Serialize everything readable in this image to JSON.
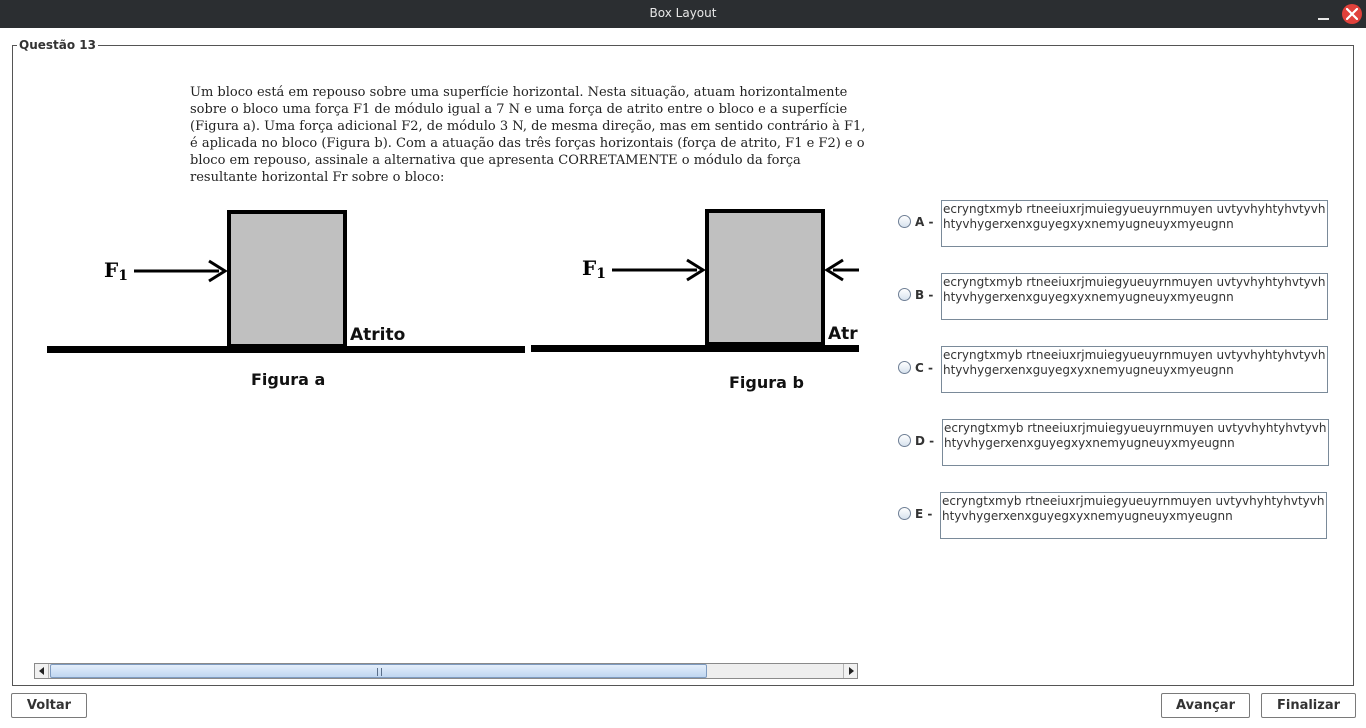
{
  "window": {
    "title": "Box Layout"
  },
  "group": {
    "title": "Questão 13"
  },
  "question": {
    "text": "Um bloco está em repouso sobre uma superfície horizontal. Nesta situação, atuam horizontalmente sobre o bloco uma força F1 de módulo igual a 7 N e uma força de atrito entre o bloco e a superfície (Figura a). Uma força adicional F2, de módulo 3 N, de mesma direção, mas em sentido contrário à F1, é aplicada no bloco (Figura b). Com a atuação das três forças horizontais (força de atrito, F1 e F2) e o bloco em repouso, assinale a alternativa que apresenta CORRETAMENTE o módulo da força resultante horizontal Fr sobre o bloco:"
  },
  "figure": {
    "force_symbol": "F",
    "force_subscript": "1",
    "friction_label_a": "Atrito",
    "friction_label_b": "Atr",
    "caption_a": "Figura a",
    "caption_b": "Figura b",
    "block_color": "#c0c0c0"
  },
  "scrollbar": {
    "position_fraction": 0.0,
    "visible_fraction": 0.83
  },
  "options": [
    {
      "letter": "A -",
      "text": "ecryngtxmyb rtneeiuxrjmuiegyueuyrnmuyen uvtyvhyhtyhvtyvhhtyvhygerxenxguyegxyxnemyugneuyxmyeugnn"
    },
    {
      "letter": "B -",
      "text": "ecryngtxmyb rtneeiuxrjmuiegyueuyrnmuyen uvtyvhyhtyhvtyvhhtyvhygerxenxguyegxyxnemyugneuyxmyeugnn"
    },
    {
      "letter": "C -",
      "text": "ecryngtxmyb rtneeiuxrjmuiegyueuyrnmuyen uvtyvhyhtyhvtyvhhtyvhygerxenxguyegxyxnemyugneuyxmyeugnn"
    },
    {
      "letter": "D -",
      "text": "ecryngtxmyb rtneeiuxrjmuiegyueuyrnmuyen uvtyvhyhtyhvtyvhhtyvhygerxenxguyegxyxnemyugneuyxmyeugnn"
    },
    {
      "letter": "E -",
      "text": "ecryngtxmyb rtneeiuxrjmuiegyueuyrnmuyen uvtyvhyhtyhvtyvhhtyvhygerxenxguyegxyxnemyugneuyxmyeugnn"
    }
  ],
  "buttons": {
    "back": "Voltar",
    "next": "Avançar",
    "finish": "Finalizar"
  }
}
